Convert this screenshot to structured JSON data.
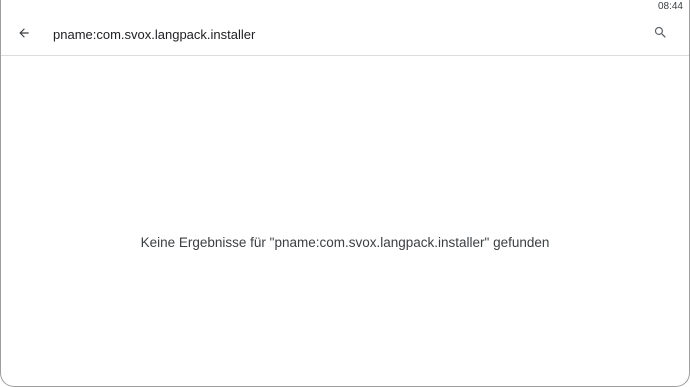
{
  "status_bar": {
    "time": "08:44"
  },
  "toolbar": {
    "back_icon": "arrow-back-icon",
    "query": "pname:com.svox.langpack.installer",
    "search_icon": "search-icon"
  },
  "results": {
    "empty_message": "Keine Ergebnisse für \"pname:com.svox.langpack.installer\" gefunden"
  }
}
